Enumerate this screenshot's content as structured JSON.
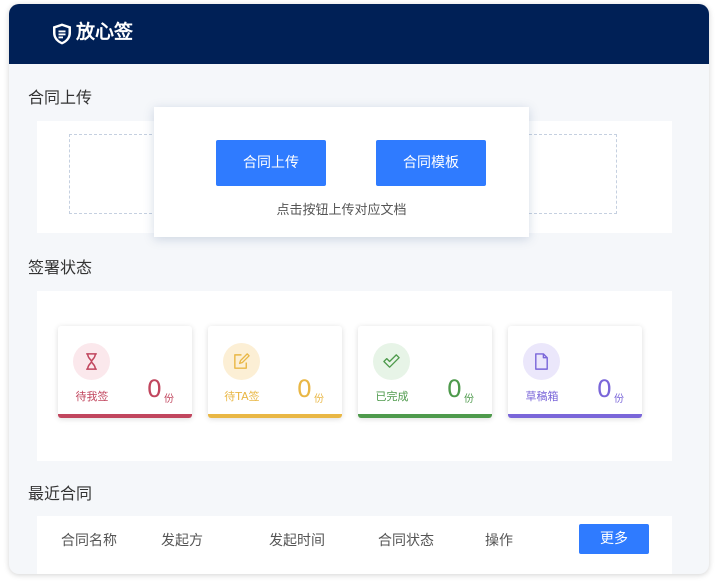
{
  "header": {
    "brand": "放心签",
    "logo_icon": "shield-icon",
    "bg_color": "#002056"
  },
  "upload_section": {
    "title": "合同上传",
    "upload_button": "合同上传",
    "template_button": "合同模板",
    "hint": "点击按钮上传对应文档"
  },
  "status_section": {
    "title": "签署状态",
    "cards": [
      {
        "label": "待我签",
        "count": "0",
        "unit": "份",
        "icon": "hourglass-icon",
        "color": "#c1465e",
        "icon_bg": "#fbe8ec"
      },
      {
        "label": "待TA签",
        "count": "0",
        "unit": "份",
        "icon": "edit-note-icon",
        "color": "#e9b745",
        "icon_bg": "#fcefd5"
      },
      {
        "label": "已完成",
        "count": "0",
        "unit": "份",
        "icon": "check-icon",
        "color": "#4e9a4c",
        "icon_bg": "#e7f4e7"
      },
      {
        "label": "草稿箱",
        "count": "0",
        "unit": "份",
        "icon": "document-icon",
        "color": "#7a66d9",
        "icon_bg": "#ebe7fb"
      }
    ]
  },
  "recent_section": {
    "title": "最近合同",
    "columns": [
      "合同名称",
      "发起方",
      "发起时间",
      "合同状态",
      "操作"
    ],
    "more_button": "更多"
  },
  "accent_color": "#2f7bff"
}
